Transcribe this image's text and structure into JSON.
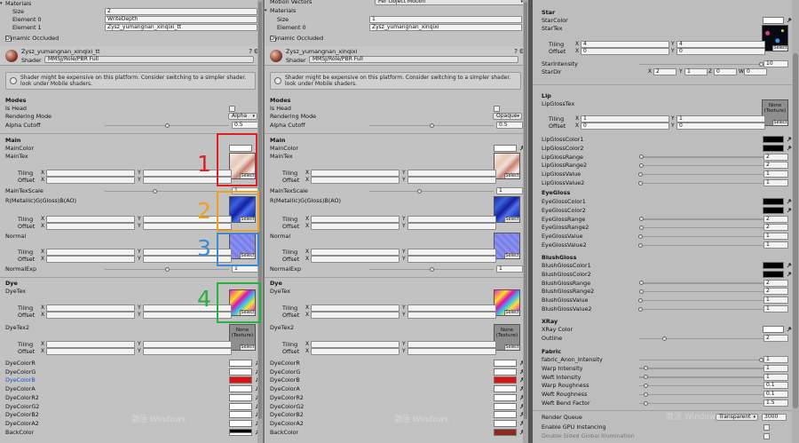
{
  "panels": [
    {
      "id": "p1",
      "ui": "panel1"
    },
    {
      "id": "p2",
      "ui": "panel2"
    }
  ],
  "panel1": {
    "materials": "Materials",
    "size_label": "Size",
    "size_value": "2",
    "element0_label": "Element 0",
    "element0_value": "WriteDepth",
    "element1_label": "Element 1",
    "element1_value": "Zysz_yumangnan_xinqixi_tt",
    "dynamic_occluded": "Dynamic Occluded",
    "material_name": "Zysz_yumangnan_xinqixi_tt",
    "shader_label": "Shader",
    "shader_value": "MMSJ/Role/PBR Full",
    "warning": "Shader might be expensive on this platform. Consider switching to a simpler shader. look under Mobile shaders.",
    "modes": "Modes",
    "is_head": "Is Head",
    "rendering_mode": "Rendering Mode",
    "rendering_value": "Alpha",
    "alpha_cutoff": "Alpha Cutoff",
    "alpha_value": "0.5",
    "main": "Main",
    "main_color": "MainColor",
    "main_tex": "MainTex",
    "maintex_scale": "MainTexScale",
    "maintex_scale_value": "1",
    "rmgao": "R(Metallic)G(Gloss)B(AO)",
    "normal": "Normal",
    "normal_exp": "NormalExp",
    "normal_exp_value": "1",
    "dye": "Dye",
    "dye_tex": "DyeTex",
    "dye_tex2": "DyeTex2",
    "dye_colors": [
      "DyeColorR",
      "DyeColorG",
      "DyeColorB",
      "DyeColorA",
      "DyeColorR2",
      "DyeColorG2",
      "DyeColorB2",
      "DyeColorA2",
      "BackColor"
    ]
  },
  "panel2": {
    "motion_vectors": "Motion Vectors",
    "motion_value": "Per Object Motion",
    "materials": "Materials",
    "size_label": "Size",
    "size_value": "1",
    "element0_label": "Element 0",
    "element0_value": "Zysz_yumangnan_xinqixi",
    "dynamic_occluded": "Dynamic Occluded",
    "material_name": "Zysz_yumangnan_xinqixi",
    "shader_label": "Shader",
    "shader_value": "MMSJ/Role/PBR Full",
    "warning": "Shader might be expensive on this platform. Consider switching to a simpler shader. look under Mobile shaders.",
    "rendering_value": "Opaque",
    "alpha_value": "0.5"
  },
  "common": {
    "tiling": "Tiling",
    "offset": "Offset",
    "x": "X",
    "y": "Y",
    "one": "1",
    "zero": "0",
    "none_texture": "None\n(Texture)",
    "select": "Select"
  },
  "panel3": {
    "star": "Star",
    "star_color": "StarColor",
    "star_tex": "StarTex",
    "tiling_x": "4",
    "tiling_y": "4",
    "star_intensity": "StarIntensity",
    "star_intensity_value": "10",
    "star_dir": "StarDir",
    "star_dir_x": "2",
    "star_dir_y": "1",
    "star_dir_z": "0",
    "star_dir_w": "0",
    "z": "Z",
    "w": "W",
    "lip": "Lip",
    "lip_gloss_tex": "LipGlossTex",
    "lip_items": [
      {
        "label": "LipGlossColor1",
        "type": "color",
        "color": "#000000"
      },
      {
        "label": "LipGlossColor2",
        "type": "color",
        "color": "#000000"
      },
      {
        "label": "LipGlossRange",
        "type": "slider",
        "value": "2"
      },
      {
        "label": "LipGlossRange2",
        "type": "slider",
        "value": "2"
      },
      {
        "label": "LipGlossValue",
        "type": "slider",
        "value": "1"
      },
      {
        "label": "LipGlossValue2",
        "type": "slider",
        "value": "1"
      }
    ],
    "eye_gloss": "EyeGloss",
    "eye_items": [
      {
        "label": "EyeGlossColor1",
        "type": "color",
        "color": "#000000"
      },
      {
        "label": "EyeGlossColor2",
        "type": "color",
        "color": "#000000"
      },
      {
        "label": "EyeGlossRange",
        "type": "slider",
        "value": "2"
      },
      {
        "label": "EyeGlossRange2",
        "type": "slider",
        "value": "2"
      },
      {
        "label": "EyeGlossValue",
        "type": "slider",
        "value": "1"
      },
      {
        "label": "EyeGlossValue2",
        "type": "slider",
        "value": "1"
      }
    ],
    "blush_gloss": "BlushGloss",
    "blush_items": [
      {
        "label": "BlushGlossColor1",
        "type": "color",
        "color": "#000000"
      },
      {
        "label": "BlushGlossColor2",
        "type": "color",
        "color": "#000000"
      },
      {
        "label": "BlushGlossRange",
        "type": "slider",
        "value": "2"
      },
      {
        "label": "BlushGlossRange2",
        "type": "slider",
        "value": "2"
      },
      {
        "label": "BlushGlossValue",
        "type": "slider",
        "value": "1"
      },
      {
        "label": "BlushGlossValue2",
        "type": "slider",
        "value": "1"
      }
    ],
    "xray": "XRay",
    "xray_color": "XRay Color",
    "outline": "Outline",
    "outline_value": "2",
    "fabric": "Fabric",
    "fabric_items": [
      {
        "label": "fabric_Anon_Intensity",
        "value": "1"
      },
      {
        "label": "Warp Intensity",
        "value": "1"
      },
      {
        "label": "Weft Intensity",
        "value": "1"
      },
      {
        "label": "Warp Roughness",
        "value": "0.1"
      },
      {
        "label": "Weft Roughness",
        "value": "0.1"
      },
      {
        "label": "Weft Bend Factor",
        "value": "1.5"
      }
    ],
    "render_queue": "Render Queue",
    "render_queue_mode": "Transparent",
    "render_queue_value": "3000",
    "gpu_instancing": "Enable GPU Instancing",
    "double_sided": "Double Sided Global Illumination"
  },
  "annotations": [
    "1",
    "2",
    "3",
    "4"
  ],
  "watermark": "激活 Windows",
  "colors": {
    "annot1": "#e02020",
    "annot2": "#f0a020",
    "annot3": "#3a8ad8",
    "annot4": "#28b040",
    "dyeB": "#e01010",
    "blueLabel": "#2050c8"
  }
}
